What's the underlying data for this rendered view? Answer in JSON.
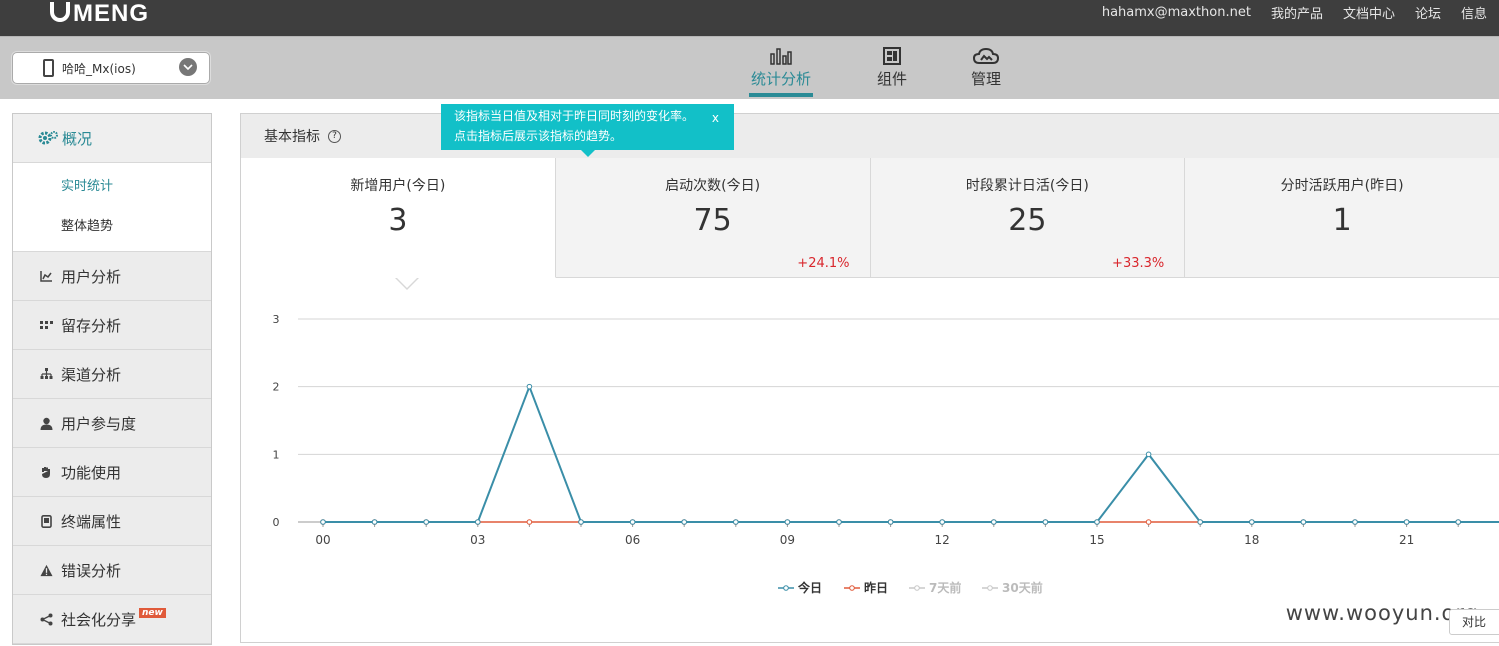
{
  "brand": {
    "logo_text": "MENG"
  },
  "top_links": [
    "hahamx@maxthon.net",
    "我的产品",
    "文档中心",
    "论坛",
    "信息"
  ],
  "app_selector": {
    "value": "哈哈_Mx(ios)"
  },
  "nav_tabs": [
    {
      "label": "统计分析",
      "icon": "bar-chart-icon",
      "active": true
    },
    {
      "label": "组件",
      "icon": "components-icon",
      "active": false
    },
    {
      "label": "管理",
      "icon": "cloud-manage-icon",
      "active": false
    }
  ],
  "sidebar": {
    "header": {
      "label": "概况",
      "icon": "gear-icon"
    },
    "subitems": [
      {
        "label": "实时统计",
        "active": true
      },
      {
        "label": "整体趋势",
        "active": false
      }
    ],
    "items": [
      {
        "label": "用户分析",
        "icon": "line-chart-icon"
      },
      {
        "label": "留存分析",
        "icon": "grid-icon"
      },
      {
        "label": "渠道分析",
        "icon": "sitemap-icon"
      },
      {
        "label": "用户参与度",
        "icon": "user-icon"
      },
      {
        "label": "功能使用",
        "icon": "hand-icon"
      },
      {
        "label": "终端属性",
        "icon": "tablet-icon"
      },
      {
        "label": "错误分析",
        "icon": "warning-icon"
      },
      {
        "label": "社会化分享",
        "icon": "share-icon",
        "badge": "new"
      }
    ]
  },
  "panel": {
    "title": "基本指标",
    "help": "?",
    "tooltip": {
      "line1": "该指标当日值及相对于昨日同时刻的变化率。",
      "line2": "点击指标后展示该指标的趋势。",
      "close": "x"
    },
    "metrics": [
      {
        "title": "新增用户(今日)",
        "value": "3",
        "delta": "",
        "active": true
      },
      {
        "title": "启动次数(今日)",
        "value": "75",
        "delta": "+24.1%",
        "active": false
      },
      {
        "title": "时段累计日活(今日)",
        "value": "25",
        "delta": "+33.3%",
        "active": false
      },
      {
        "title": "分时活跃用户(昨日)",
        "value": "1",
        "delta": "",
        "active": false
      }
    ]
  },
  "chart_data": {
    "type": "line",
    "x_tick_labels": [
      "00",
      "03",
      "06",
      "09",
      "12",
      "15",
      "18",
      "21"
    ],
    "x": [
      0,
      1,
      2,
      3,
      4,
      5,
      6,
      7,
      8,
      9,
      10,
      11,
      12,
      13,
      14,
      15,
      16,
      17,
      18,
      19,
      20,
      21,
      22,
      23
    ],
    "ylim": [
      0,
      3
    ],
    "y_ticks": [
      0,
      1,
      2,
      3
    ],
    "grid": true,
    "legend_position": "bottom",
    "series": [
      {
        "name": "今日",
        "color": "#3a8ea8",
        "values": [
          0,
          0,
          0,
          0,
          2,
          0,
          0,
          0,
          0,
          0,
          0,
          0,
          0,
          0,
          0,
          0,
          1,
          0,
          0,
          0,
          0,
          0,
          0,
          0
        ]
      },
      {
        "name": "昨日",
        "color": "#e05a3a",
        "values": [
          0,
          0,
          0,
          0,
          0,
          0,
          0,
          0,
          0,
          0,
          0,
          0,
          0,
          0,
          0,
          0,
          0,
          0,
          0,
          0,
          0,
          0,
          0,
          0
        ]
      },
      {
        "name": "7天前",
        "color": "#c8c8c8",
        "values": []
      },
      {
        "name": "30天前",
        "color": "#c8c8c8",
        "values": []
      }
    ]
  },
  "watermark": "www.wooyun.org",
  "compare_label": "对比"
}
